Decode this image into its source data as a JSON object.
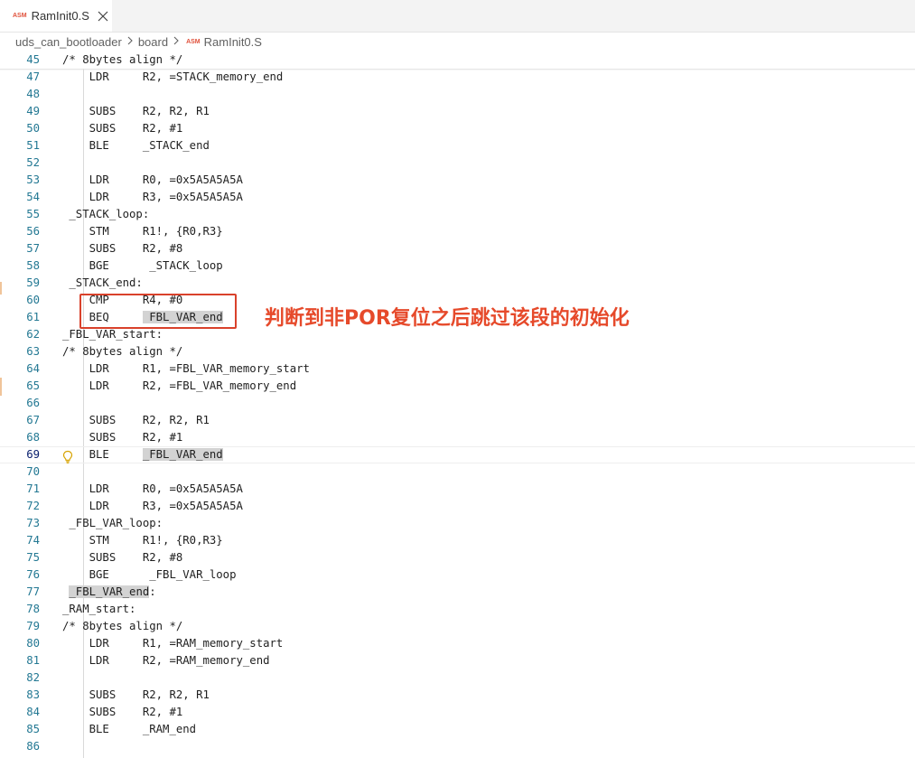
{
  "tab": {
    "badge": "ASM",
    "label": "RamInit0.S"
  },
  "breadcrumb": {
    "items": [
      "uds_can_bootloader",
      "board"
    ],
    "badge": "ASM",
    "file": "RamInit0.S"
  },
  "annotation": "判断到非POR复位之后跳过该段的初始化",
  "code": {
    "lines": [
      {
        "n": "45",
        "text": "/* 8bytes align */"
      },
      {
        "n": "47",
        "text": "    LDR     R2, =STACK_memory_end"
      },
      {
        "n": "48",
        "text": ""
      },
      {
        "n": "49",
        "text": "    SUBS    R2, R2, R1"
      },
      {
        "n": "50",
        "text": "    SUBS    R2, #1"
      },
      {
        "n": "51",
        "text": "    BLE     _STACK_end"
      },
      {
        "n": "52",
        "text": ""
      },
      {
        "n": "53",
        "text": "    LDR     R0, =0x5A5A5A5A"
      },
      {
        "n": "54",
        "text": "    LDR     R3, =0x5A5A5A5A"
      },
      {
        "n": "55",
        "text": " _STACK_loop:"
      },
      {
        "n": "56",
        "text": "    STM     R1!, {R0,R3}"
      },
      {
        "n": "57",
        "text": "    SUBS    R2, #8"
      },
      {
        "n": "58",
        "text": "    BGE      _STACK_loop"
      },
      {
        "n": "59",
        "text": " _STACK_end:"
      },
      {
        "n": "60",
        "text": "    CMP     R4, #0"
      },
      {
        "n": "61",
        "pre": "    BEQ     ",
        "hl": " FBL_VAR_end",
        "post": ""
      },
      {
        "n": "62",
        "text": "_FBL_VAR_start:"
      },
      {
        "n": "63",
        "text": "/* 8bytes align */"
      },
      {
        "n": "64",
        "text": "    LDR     R1, =FBL_VAR_memory_start"
      },
      {
        "n": "65",
        "text": "    LDR     R2, =FBL_VAR_memory_end"
      },
      {
        "n": "66",
        "text": ""
      },
      {
        "n": "67",
        "text": "    SUBS    R2, R2, R1"
      },
      {
        "n": "68",
        "text": "    SUBS    R2, #1"
      },
      {
        "n": "69",
        "pre": "    BLE     ",
        "hl": "_FBL_VAR_end",
        "post": "",
        "active": true
      },
      {
        "n": "70",
        "text": ""
      },
      {
        "n": "71",
        "text": "    LDR     R0, =0x5A5A5A5A"
      },
      {
        "n": "72",
        "text": "    LDR     R3, =0x5A5A5A5A"
      },
      {
        "n": "73",
        "text": " _FBL_VAR_loop:"
      },
      {
        "n": "74",
        "text": "    STM     R1!, {R0,R3}"
      },
      {
        "n": "75",
        "text": "    SUBS    R2, #8"
      },
      {
        "n": "76",
        "text": "    BGE      _FBL_VAR_loop"
      },
      {
        "n": "77",
        "pre": " ",
        "hl": "_FBL_VAR_end",
        "post": ":"
      },
      {
        "n": "78",
        "text": "_RAM_start:"
      },
      {
        "n": "79",
        "text": "/* 8bytes align */"
      },
      {
        "n": "80",
        "text": "    LDR     R1, =RAM_memory_start"
      },
      {
        "n": "81",
        "text": "    LDR     R2, =RAM_memory_end"
      },
      {
        "n": "82",
        "text": ""
      },
      {
        "n": "83",
        "text": "    SUBS    R2, R2, R1"
      },
      {
        "n": "84",
        "text": "    SUBS    R2, #1"
      },
      {
        "n": "85",
        "text": "    BLE     _RAM_end"
      },
      {
        "n": "86",
        "text": ""
      }
    ]
  }
}
